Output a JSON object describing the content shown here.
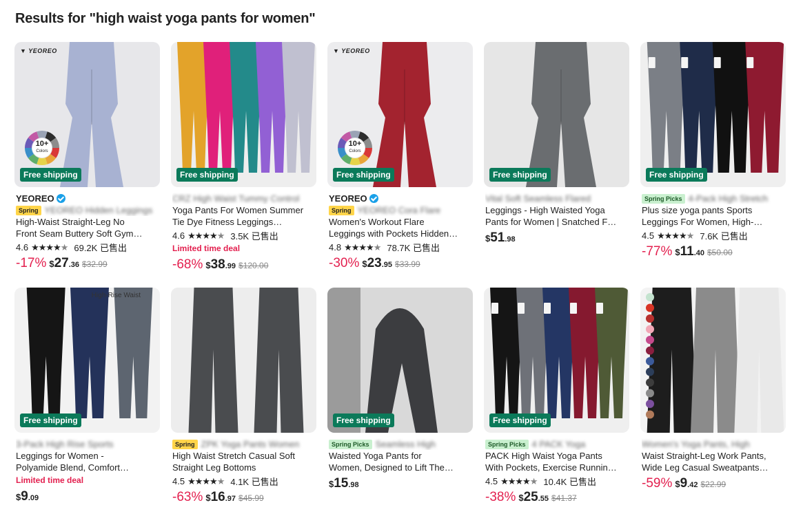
{
  "page": {
    "title": "Results for \"high waist yoga pants for women\""
  },
  "colors": {
    "free_shipping": "#0b7a5a",
    "discount": "#e3204f",
    "verified": "#1aa0e8",
    "spring_tag": "#ffd54a",
    "picks_tag": "#c9f0cf"
  },
  "products": [
    {
      "img": {
        "bg": "#e7e7ea",
        "pants": [
          "#a8b2d2"
        ],
        "style": "flare",
        "brand_logo": "YEOREO",
        "wheel": "10+",
        "wheel_sub": "Colors",
        "free_shipping": "Free shipping"
      },
      "brand": "YEOREO",
      "verified": true,
      "tag": "Spring",
      "tag_type": "spring",
      "title_blur": "YEOREO Hidden Leggings",
      "title_lines": [
        "High-Waist Straight-Leg No",
        "Front Seam Buttery Soft Gym…"
      ],
      "rating": "4.6",
      "stars": 4.5,
      "sold": "69.2K 已售出",
      "limited": "",
      "discount": "-17%",
      "price_int": "27",
      "price_cents": ".36",
      "orig": "$32.99"
    },
    {
      "img": {
        "bg": "#eeeeee",
        "pants": [
          "#e3a32a",
          "#e0207a",
          "#238a8a",
          "#9260d4",
          "#c0c0d0"
        ],
        "style": "multi-tiedye",
        "free_shipping": "Free shipping"
      },
      "brand": "",
      "verified": false,
      "tag": "",
      "tag_type": "",
      "title_blur": "CRZ High Waist Tummy Control",
      "title_lines": [
        "Yoga Pants For Women Summer",
        "Tie Dye Fitness Leggings…"
      ],
      "rating": "4.6",
      "stars": 4.5,
      "sold": "3.5K 已售出",
      "limited": "Limited time deal",
      "discount": "-68%",
      "price_int": "38",
      "price_cents": ".99",
      "orig": "$120.00"
    },
    {
      "img": {
        "bg": "#ececee",
        "pants": [
          "#a3232f"
        ],
        "style": "flare-pocket",
        "brand_logo": "YEOREO",
        "wheel": "10+",
        "wheel_sub": "Colors",
        "free_shipping": "Free shipping"
      },
      "brand": "YEOREO",
      "verified": true,
      "tag": "Spring",
      "tag_type": "spring",
      "title_blur": "YEOREO Cora Flare",
      "title_lines": [
        "Women's Workout Flare",
        "Leggings with Pockets Hidden…"
      ],
      "rating": "4.8",
      "stars": 4.5,
      "sold": "78.7K 已售出",
      "limited": "",
      "discount": "-30%",
      "price_int": "23",
      "price_cents": ".95",
      "orig": "$33.99"
    },
    {
      "img": {
        "bg": "#e6e6e6",
        "pants": [
          "#6a6d70"
        ],
        "style": "flare-close",
        "free_shipping": "Free shipping"
      },
      "brand": "",
      "verified": false,
      "tag": "",
      "tag_type": "",
      "title_blur": "Vital Soft Seamless Flared",
      "title_lines": [
        "Leggings - High Waisted Yoga",
        "Pants for Women | Snatched F…"
      ],
      "rating": "",
      "stars": 0,
      "sold": "",
      "limited": "",
      "discount": "",
      "price_int": "51",
      "price_cents": ".98",
      "orig": ""
    },
    {
      "img": {
        "bg": "#efefef",
        "pants": [
          "#7b7f86",
          "#1f2c49",
          "#111111",
          "#8e1a30"
        ],
        "style": "multi-pocket",
        "free_shipping": "Free shipping"
      },
      "brand": "",
      "verified": false,
      "tag": "Spring Picks",
      "tag_type": "picks",
      "title_blur": "4-Pack High Stretch",
      "title_lines": [
        "Plus size yoga pants Sports",
        "Leggings For Women, High-…"
      ],
      "rating": "4.5",
      "stars": 4.5,
      "sold": "7.6K 已售出",
      "limited": "",
      "discount": "-77%",
      "price_int": "11",
      "price_cents": ".40",
      "orig": "$50.00"
    },
    {
      "img": {
        "bg": "#f2f2f2",
        "pants": [
          "#151515",
          "#24325a",
          "#5d6570"
        ],
        "style": "multi-run",
        "rise_label": "High-Rise Waist",
        "free_shipping": "Free shipping"
      },
      "brand": "",
      "verified": false,
      "tag": "",
      "tag_type": "",
      "title_blur": "3-Pack High Rise Sports",
      "title_lines": [
        "Leggings for Women -",
        "Polyamide Blend, Comfort…"
      ],
      "rating": "",
      "stars": 0,
      "sold": "",
      "limited": "Limited time deal",
      "discount": "",
      "price_int": "9",
      "price_cents": ".09",
      "orig": ""
    },
    {
      "img": {
        "bg": "#ededed",
        "pants": [
          "#4a4c4f",
          "#4a4c4f"
        ],
        "style": "wide-pair"
      },
      "brand": "",
      "verified": false,
      "tag": "Spring",
      "tag_type": "spring",
      "title_blur": "ZPK Yoga Pants Women",
      "title_lines": [
        "High Waist Stretch Casual Soft",
        "Straight Leg Bottoms"
      ],
      "rating": "4.5",
      "stars": 4.5,
      "sold": "4.1K 已售出",
      "limited": "",
      "discount": "-63%",
      "price_int": "16",
      "price_cents": ".97",
      "orig": "$45.99"
    },
    {
      "img": {
        "bg": "#d9d9d9",
        "pants": [
          "#3c3d40"
        ],
        "style": "scrunch",
        "free_shipping": "Free shipping"
      },
      "brand": "",
      "verified": false,
      "tag": "Spring Picks",
      "tag_type": "picks",
      "title_blur": "Seamless High",
      "title_lines": [
        "Waisted Yoga Pants for",
        "Women, Designed to Lift The…"
      ],
      "rating": "",
      "stars": 0,
      "sold": "",
      "limited": "",
      "discount": "",
      "price_int": "15",
      "price_cents": ".98",
      "orig": ""
    },
    {
      "img": {
        "bg": "#efefef",
        "pants": [
          "#151515",
          "#6e7178",
          "#243664",
          "#85192f",
          "#4f5a36"
        ],
        "style": "multi-pocket",
        "free_shipping": "Free shipping"
      },
      "brand": "",
      "verified": false,
      "tag": "Spring Picks",
      "tag_type": "picks",
      "title_blur": "4 PACK Yoga",
      "title_lines": [
        "PACK High Waist Yoga Pants",
        "With Pockets, Exercise Runnin…"
      ],
      "rating": "4.5",
      "stars": 4.5,
      "sold": "10.4K 已售出",
      "limited": "",
      "discount": "-38%",
      "price_int": "25",
      "price_cents": ".55",
      "orig": "$41.37"
    },
    {
      "img": {
        "bg": "#f3f3f3",
        "pants": [
          "#1d1d1d",
          "#8b8b8b",
          "#e9e9e9"
        ],
        "style": "wide-swatch"
      },
      "brand": "",
      "verified": false,
      "tag": "",
      "tag_type": "",
      "title_blur": "Women's Yoga Pants, High",
      "title_lines": [
        "Waist Straight-Leg Work Pants,",
        "Wide Leg Casual Sweatpants…"
      ],
      "rating": "",
      "stars": 0,
      "sold": "",
      "limited": "",
      "discount": "-59%",
      "price_int": "9",
      "price_cents": ".42",
      "orig": "$22.99"
    }
  ]
}
